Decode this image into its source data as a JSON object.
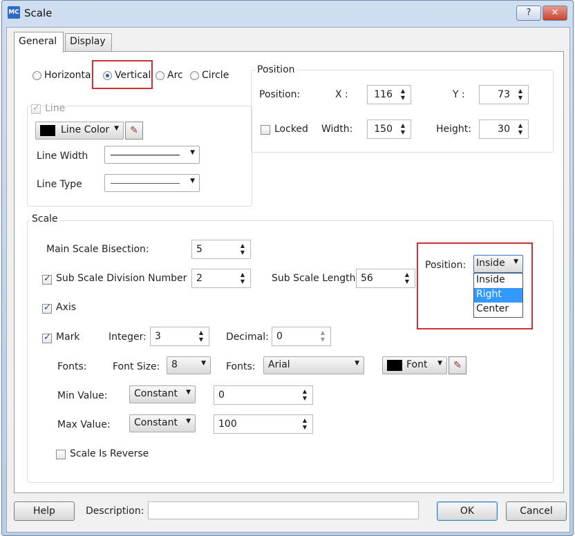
{
  "window": {
    "title": "Scale",
    "app_icon": "MC",
    "help_glyph": "?",
    "close_glyph": "✕"
  },
  "tabs": [
    {
      "label": "General",
      "active": true
    },
    {
      "label": "Display",
      "active": false
    }
  ],
  "orientation": {
    "options": [
      "Horizontal",
      "Vertical",
      "Arc",
      "Circle"
    ],
    "selected": "Vertical"
  },
  "line": {
    "checkbox_label": "Line",
    "color_label": "Line Color",
    "width_label": "Line Width",
    "type_label": "Line Type"
  },
  "position": {
    "group_title": "Position",
    "position_label": "Position:",
    "x_label": "X :",
    "x_value": "116",
    "y_label": "Y :",
    "y_value": "73",
    "locked_label": "Locked",
    "width_label": "Width:",
    "width_value": "150",
    "height_label": "Height:",
    "height_value": "30"
  },
  "scale": {
    "group_title": "Scale",
    "main_bisection_label": "Main Scale Bisection:",
    "main_bisection_value": "5",
    "sub_division_label": "Sub Scale Division Number",
    "sub_division_value": "2",
    "sub_length_label": "Sub Scale Length",
    "sub_length_value": "56",
    "axis_label": "Axis",
    "mark_label": "Mark",
    "integer_label": "Integer:",
    "integer_value": "3",
    "decimal_label": "Decimal:",
    "decimal_value": "0",
    "fonts_label": "Fonts:",
    "font_size_label": "Font Size:",
    "font_size_value": "8",
    "fonts2_label": "Fonts:",
    "font_name": "Arial",
    "font_color_label": "Font",
    "min_value_label": "Min Value:",
    "min_mode": "Constant",
    "min_value": "0",
    "max_value_label": "Max Value:",
    "max_mode": "Constant",
    "max_value": "100",
    "reverse_label": "Scale Is Reverse",
    "position_label": "Position:",
    "position_value": "Inside",
    "position_options": [
      "Inside",
      "Right",
      "Center"
    ],
    "position_highlighted": "Right"
  },
  "footer": {
    "help_label": "Help",
    "description_label": "Description:",
    "description_value": "",
    "ok_label": "OK",
    "cancel_label": "Cancel"
  },
  "icons": {
    "spin_glyph": "▲▼",
    "dropdown_glyph": "▼",
    "picker_glyph": "✎"
  },
  "colors": {
    "accent": "#3399ff",
    "highlight_box": "#d23030",
    "line_color": "#000000",
    "font_color": "#000000"
  }
}
